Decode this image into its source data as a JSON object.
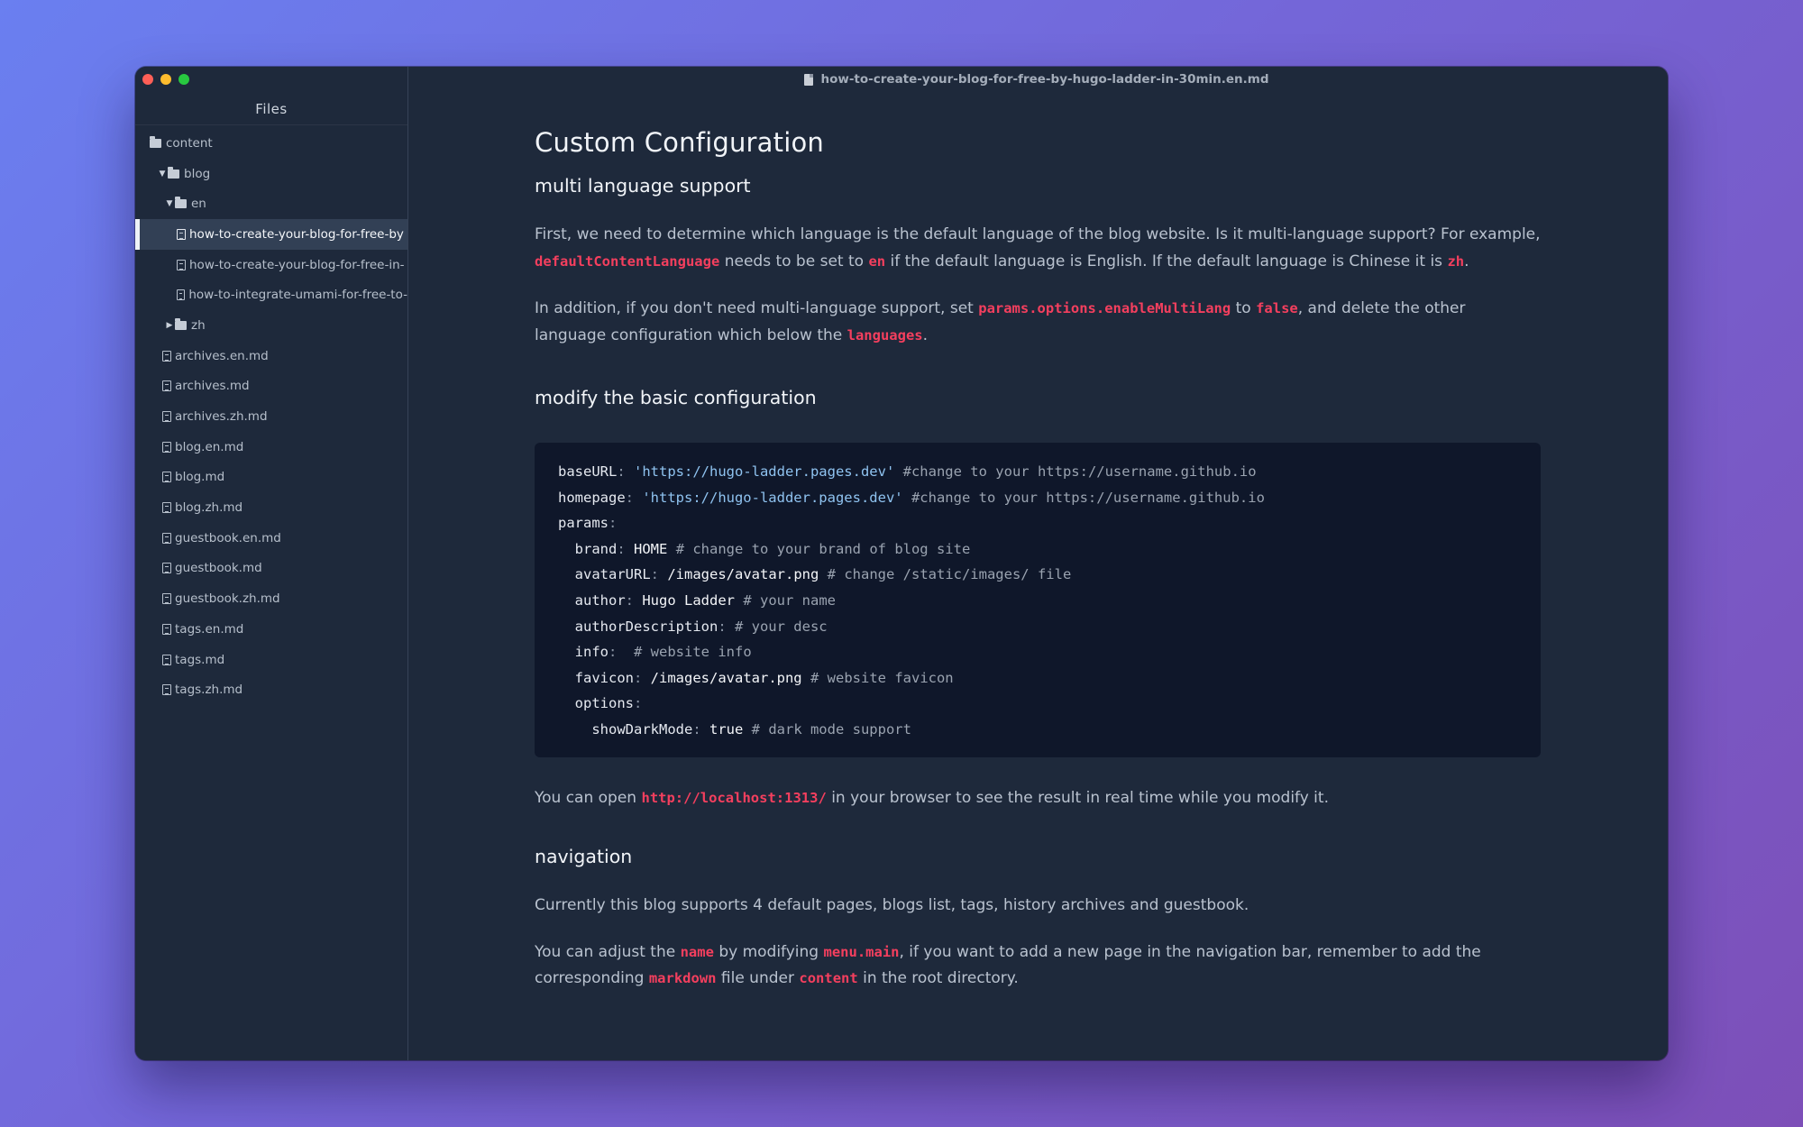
{
  "window": {
    "title": "how-to-create-your-blog-for-free-by-hugo-ladder-in-30min.en.md"
  },
  "sidebar": {
    "title": "Files",
    "tree": [
      {
        "label": "content",
        "type": "folder",
        "depth": 0,
        "expanded": true
      },
      {
        "label": "blog",
        "type": "folder",
        "depth": 1,
        "expanded": true
      },
      {
        "label": "en",
        "type": "folder",
        "depth": 2,
        "expanded": true
      },
      {
        "label": "how-to-create-your-blog-for-free-by",
        "type": "file",
        "depth": 3,
        "selected": true
      },
      {
        "label": "how-to-create-your-blog-for-free-in-",
        "type": "file",
        "depth": 3
      },
      {
        "label": "how-to-integrate-umami-for-free-to-",
        "type": "file",
        "depth": 3
      },
      {
        "label": "zh",
        "type": "folder",
        "depth": 2,
        "expanded": false
      },
      {
        "label": "archives.en.md",
        "type": "file",
        "depth": 1
      },
      {
        "label": "archives.md",
        "type": "file",
        "depth": 1
      },
      {
        "label": "archives.zh.md",
        "type": "file",
        "depth": 1
      },
      {
        "label": "blog.en.md",
        "type": "file",
        "depth": 1
      },
      {
        "label": "blog.md",
        "type": "file",
        "depth": 1
      },
      {
        "label": "blog.zh.md",
        "type": "file",
        "depth": 1
      },
      {
        "label": "guestbook.en.md",
        "type": "file",
        "depth": 1
      },
      {
        "label": "guestbook.md",
        "type": "file",
        "depth": 1
      },
      {
        "label": "guestbook.zh.md",
        "type": "file",
        "depth": 1
      },
      {
        "label": "tags.en.md",
        "type": "file",
        "depth": 1
      },
      {
        "label": "tags.md",
        "type": "file",
        "depth": 1
      },
      {
        "label": "tags.zh.md",
        "type": "file",
        "depth": 1
      }
    ]
  },
  "article": {
    "h1": "Custom Configuration",
    "h2_multi": "multi language support",
    "p1": {
      "t1": "First, we need to determine which language is the default language of the blog website. Is it multi-language support? For example, ",
      "c1": "defaultContentLanguage",
      "t2": " needs to be set to ",
      "c2": "en",
      "t3": " if the default language is English. If the default language is Chinese it is ",
      "c3": "zh",
      "t4": "."
    },
    "p2": {
      "t1": "In addition, if you don't need multi-language support, set ",
      "c1": "params.options.enableMultiLang",
      "t2": " to ",
      "c2": "false",
      "t3": ", and delete the other language  configuration which below the ",
      "c3": "languages",
      "t4": "."
    },
    "h2_basic": "modify the basic configuration",
    "code": {
      "l1_key": "baseURL",
      "l1_val": "'https://hugo-ladder.pages.dev'",
      "l1_cmt": "#change to your https://username.github.io",
      "l2_key": "homepage",
      "l2_val": "'https://hugo-ladder.pages.dev'",
      "l2_cmt": "#change to your https://username.github.io",
      "l3_key": "params",
      "l4_key": "brand",
      "l4_val": "HOME",
      "l4_cmt": "# change to your brand of blog site",
      "l5_key": "avatarURL",
      "l5_val": "/images/avatar.png",
      "l5_cmt": "# change /static/images/ file",
      "l6_key": "author",
      "l6_val": "Hugo Ladder",
      "l6_cmt": "# your name",
      "l7_key": "authorDescription",
      "l7_cmt": "# your desc",
      "l8_key": "info",
      "l8_cmt": "# website info",
      "l9_key": "favicon",
      "l9_val": "/images/avatar.png",
      "l9_cmt": "# website favicon",
      "l10_key": "options",
      "l11_key": "showDarkMode",
      "l11_val": "true",
      "l11_cmt": "# dark mode support"
    },
    "p3": {
      "t1": "You can open ",
      "c1": "http://localhost:1313/",
      "t2": " in your browser to see the result in real time while you modify it."
    },
    "h2_nav": "navigation",
    "p4": "Currently this blog supports 4 default pages, blogs list, tags, history archives and guestbook.",
    "p5": {
      "t1": "You can adjust the ",
      "c1": "name",
      "t2": " by modifying ",
      "c2": "menu.main",
      "t3": ", if you want to add a new page in the navigation bar, remember to add the corresponding ",
      "c3": "markdown",
      "t4": " file under ",
      "c4": "content",
      "t5": " in the root directory."
    }
  },
  "colors": {
    "background_start": "#6a7ff0",
    "background_end": "#7d4fb8",
    "window_bg": "#1e293b",
    "code_bg": "#0f172a",
    "inline_code": "#f43f5e",
    "string": "#8fc3f0"
  }
}
